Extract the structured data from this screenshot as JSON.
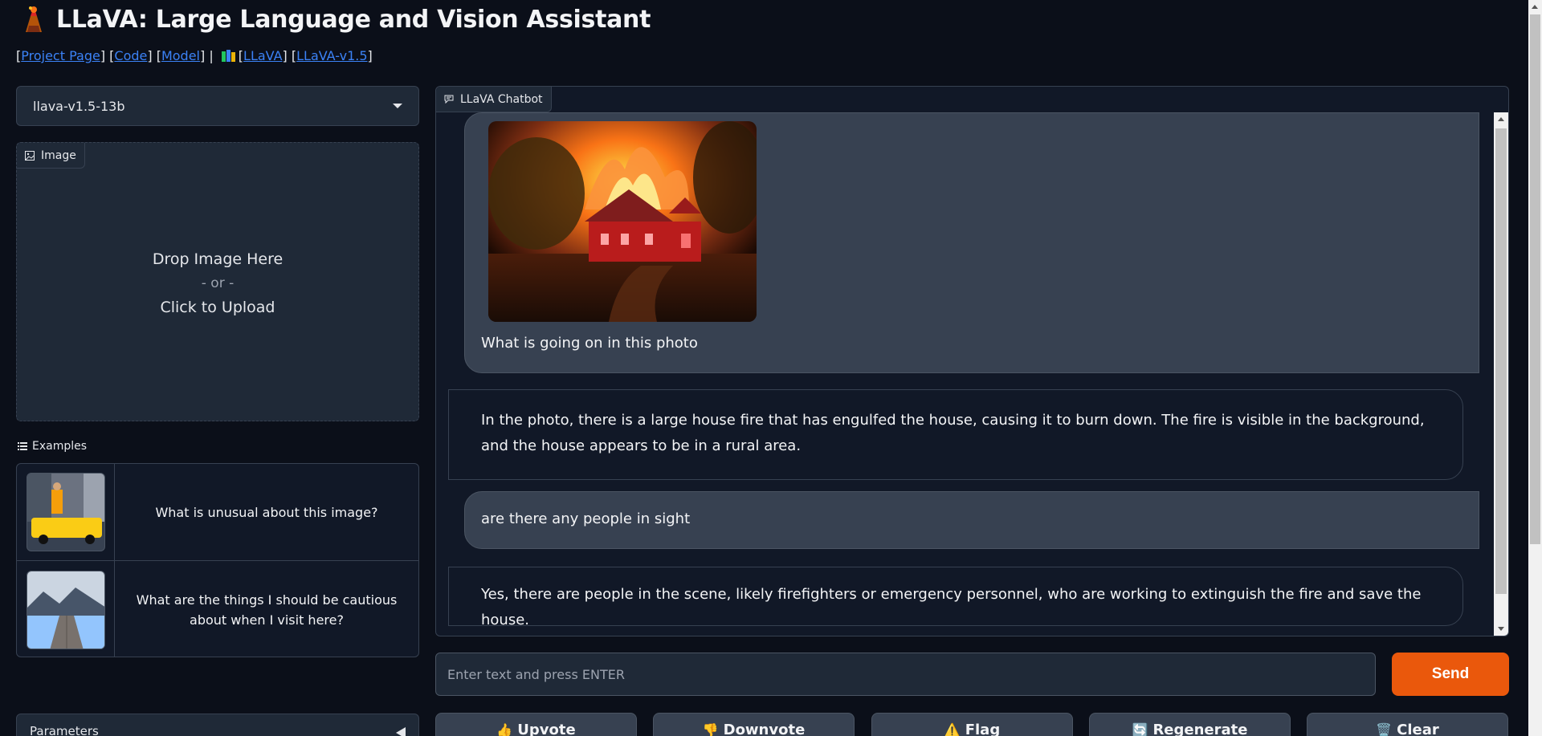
{
  "header": {
    "title": "LLaVA: Large Language and Vision Assistant",
    "links": {
      "project_page": "Project Page",
      "code": "Code",
      "model": "Model",
      "llava": "LLaVA",
      "llava_v15": "LLaVA-v1.5"
    }
  },
  "left": {
    "model_select": {
      "value": "llava-v1.5-13b"
    },
    "image_panel": {
      "label": "Image",
      "drop_text": "Drop Image Here",
      "or_text": "- or -",
      "upload_text": "Click to Upload"
    },
    "examples": {
      "label": "Examples",
      "items": [
        {
          "text": "What is unusual about this image?"
        },
        {
          "text": "What are the things I should be cautious about when I visit here?"
        }
      ]
    },
    "parameters_label": "Parameters"
  },
  "chat": {
    "label": "LLaVA Chatbot",
    "messages": [
      {
        "role": "user",
        "text": "What is going on in this photo"
      },
      {
        "role": "assistant",
        "text": "In the photo, there is a large house fire that has engulfed the house, causing it to burn down. The fire is visible in the background, and the house appears to be in a rural area."
      },
      {
        "role": "user",
        "text": "are there any people in sight"
      },
      {
        "role": "assistant",
        "text": "Yes, there are people in the scene, likely firefighters or emergency personnel, who are working to extinguish the fire and save the house."
      }
    ]
  },
  "input": {
    "placeholder": "Enter text and press ENTER",
    "send_label": "Send"
  },
  "actions": {
    "upvote": "Upvote",
    "downvote": "Downvote",
    "flag": "Flag",
    "regenerate": "Regenerate",
    "clear": "Clear"
  },
  "colors": {
    "background": "#0b0f19",
    "panel": "#1f2937",
    "border": "#374151",
    "accent": "#ea580c",
    "link": "#3b82f6"
  }
}
